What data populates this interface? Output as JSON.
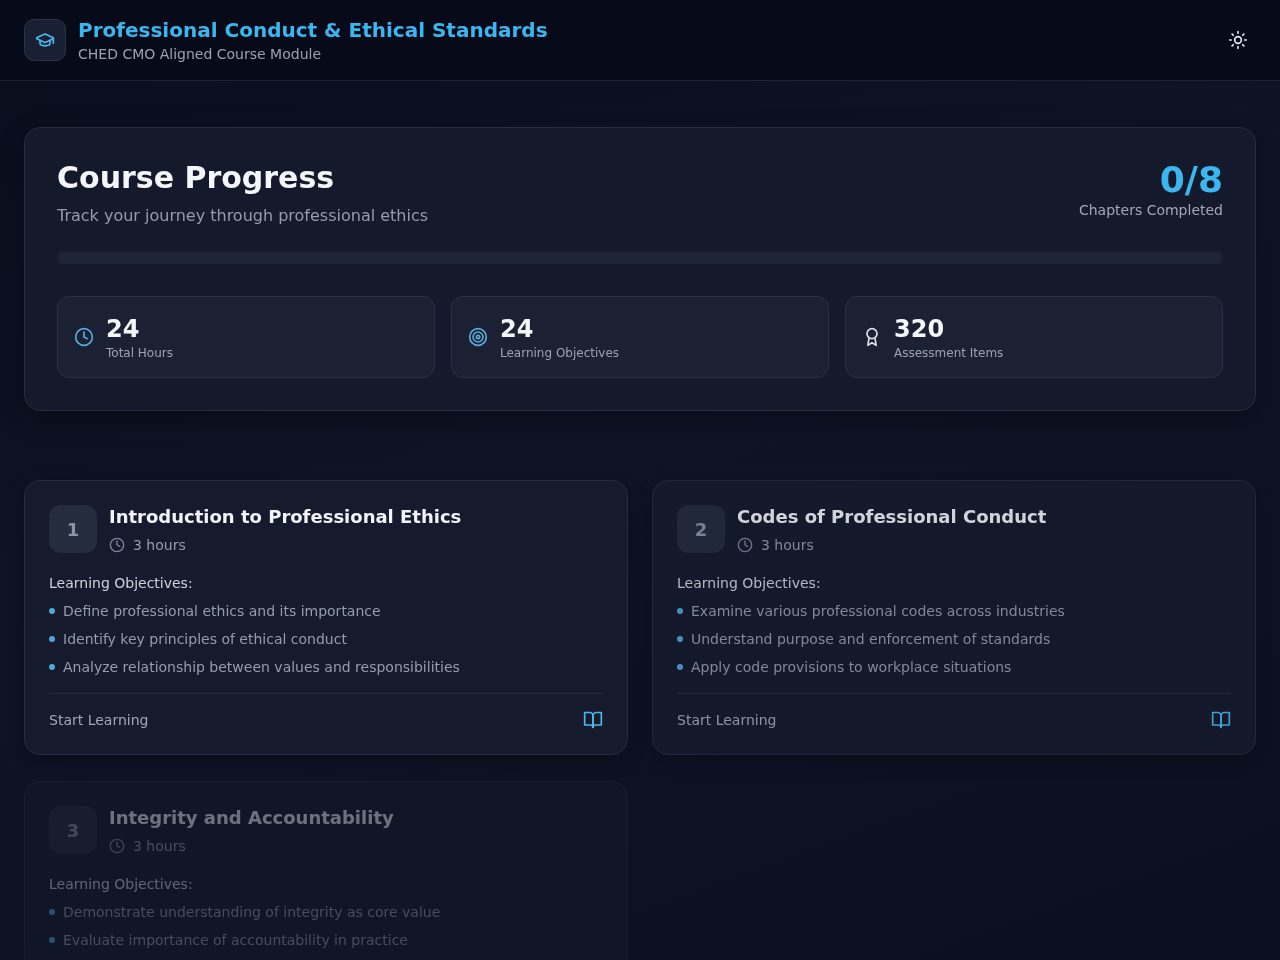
{
  "header": {
    "title": "Professional Conduct & Ethical Standards",
    "subtitle": "CHED CMO Aligned Course Module"
  },
  "progress": {
    "title": "Course Progress",
    "subtitle": "Track your journey through professional ethics",
    "completed": "0/8",
    "completed_label": "Chapters Completed",
    "stats": [
      {
        "kind": "hours",
        "value": "24",
        "label": "Total Hours"
      },
      {
        "kind": "objectives",
        "value": "24",
        "label": "Learning Objectives"
      },
      {
        "kind": "assessments",
        "value": "320",
        "label": "Assessment Items"
      }
    ]
  },
  "chapters": [
    {
      "number": "1",
      "title": "Introduction to Professional Ethics",
      "duration": "3 hours",
      "objectives_label": "Learning Objectives:",
      "objectives": [
        "Define professional ethics and its importance",
        "Identify key principles of ethical conduct",
        "Analyze relationship between values and responsibilities"
      ],
      "action": "Start Learning",
      "dimmed": false,
      "faint": false
    },
    {
      "number": "2",
      "title": "Codes of Professional Conduct",
      "duration": "3 hours",
      "objectives_label": "Learning Objectives:",
      "objectives": [
        "Examine various professional codes across industries",
        "Understand purpose and enforcement of standards",
        "Apply code provisions to workplace situations"
      ],
      "action": "Start Learning",
      "dimmed": true,
      "faint": false
    },
    {
      "number": "3",
      "title": "Integrity and Accountability",
      "duration": "3 hours",
      "objectives_label": "Learning Objectives:",
      "objectives": [
        "Demonstrate understanding of integrity as core value",
        "Evaluate importance of accountability in practice"
      ],
      "dimmed": false,
      "faint": true
    }
  ]
}
